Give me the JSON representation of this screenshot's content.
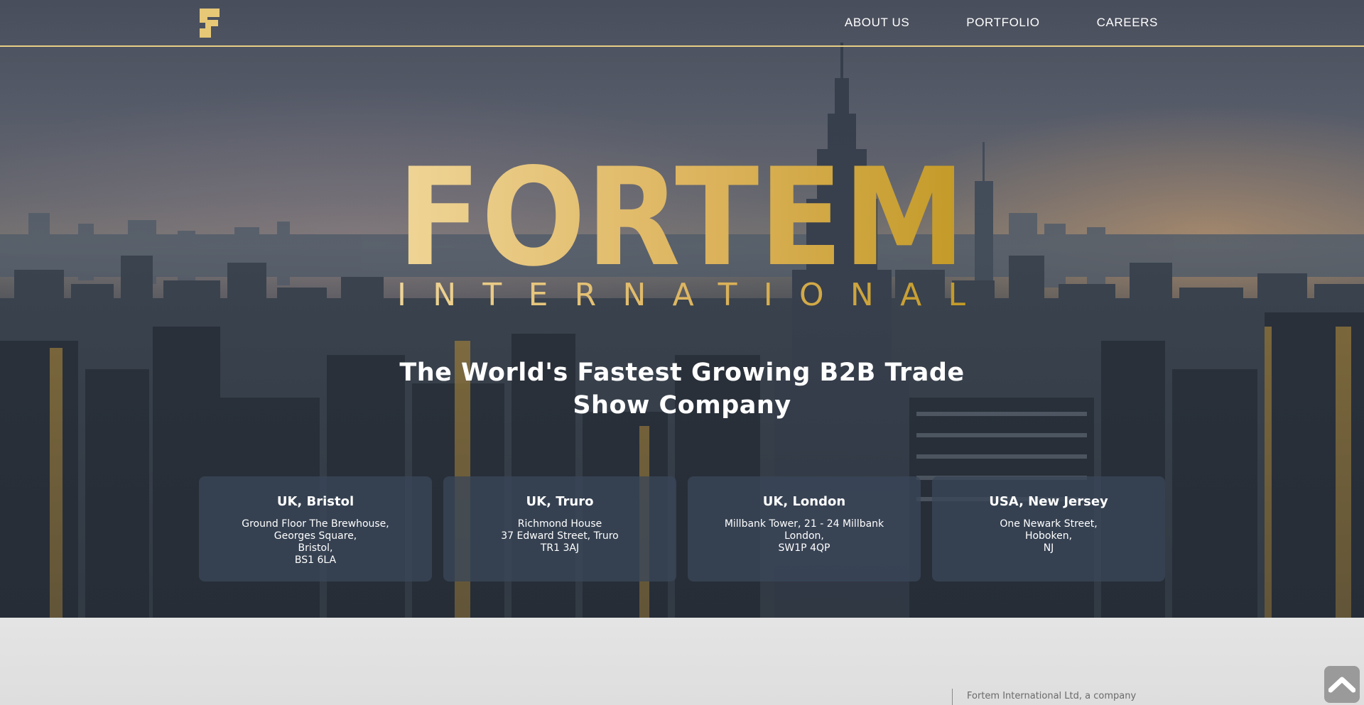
{
  "nav": {
    "logo_icon": "fortem-f-mark-icon",
    "links": [
      {
        "label": "ABOUT US"
      },
      {
        "label": "PORTFOLIO"
      },
      {
        "label": "CAREERS"
      }
    ]
  },
  "brand": {
    "logo_text": "FORTEM",
    "logo_subtext": "INTERNATIONAL",
    "tagline_line1": "The World's Fastest Growing B2B Trade",
    "tagline_line2": "Show Company"
  },
  "offices": [
    {
      "city": "UK, Bristol",
      "lines": [
        "Ground Floor The Brewhouse,",
        "Georges Square,",
        "Bristol,",
        "BS1 6LA"
      ]
    },
    {
      "city": "UK, Truro",
      "lines": [
        "Richmond House",
        "37 Edward Street, Truro",
        "TR1 3AJ"
      ]
    },
    {
      "city": "UK, London",
      "lines": [
        "Millbank Tower, 21 - 24 Millbank",
        "London,",
        "SW1P 4QP"
      ]
    },
    {
      "city": "USA, New Jersey",
      "lines": [
        "One Newark Street,",
        "Hoboken,",
        "NJ"
      ]
    }
  ],
  "footer": {
    "company_text": "Fortem International Ltd, a company"
  },
  "scroll_top": {
    "icon": "chevron-up-icon"
  },
  "colors": {
    "gold_light": "#efd495",
    "gold_dark": "#c49a28",
    "nav_border": "#e8cf86",
    "card_bg": "#3a4658",
    "footer_bg": "#e2e2e2"
  }
}
